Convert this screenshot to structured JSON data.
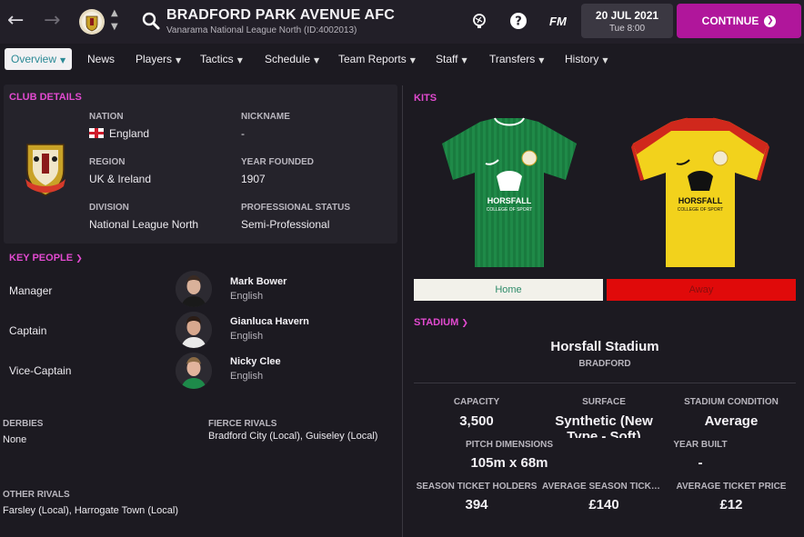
{
  "header": {
    "club_name": "BRADFORD PARK AVENUE AFC",
    "club_sub": "Vanarama National League North (ID:4002013)",
    "fm_label": "FM",
    "date": "20 JUL 2021",
    "time": "Tue 8:00",
    "continue_label": "CONTINUE"
  },
  "tabs": [
    {
      "label": "Overview"
    },
    {
      "label": "News"
    },
    {
      "label": "Players"
    },
    {
      "label": "Tactics"
    },
    {
      "label": "Schedule"
    },
    {
      "label": "Team Reports"
    },
    {
      "label": "Staff"
    },
    {
      "label": "Transfers"
    },
    {
      "label": "History"
    }
  ],
  "club_details": {
    "title": "CLUB DETAILS",
    "nation_label": "NATION",
    "nation": "England",
    "nickname_label": "NICKNAME",
    "nickname": "-",
    "region_label": "REGION",
    "region": "UK & Ireland",
    "founded_label": "YEAR FOUNDED",
    "founded": "1907",
    "division_label": "DIVISION",
    "division": "National League North",
    "status_label": "PROFESSIONAL STATUS",
    "status": "Semi-Professional"
  },
  "key_people": {
    "title": "KEY PEOPLE",
    "people": [
      {
        "role": "Manager",
        "name": "Mark Bower",
        "nationality": "English"
      },
      {
        "role": "Captain",
        "name": "Gianluca Havern",
        "nationality": "English"
      },
      {
        "role": "Vice-Captain",
        "name": "Nicky Clee",
        "nationality": "English"
      }
    ]
  },
  "rivals": {
    "derbies_label": "DERBIES",
    "derbies": "None",
    "fierce_label": "FIERCE RIVALS",
    "fierce": "Bradford City (Local), Guiseley (Local)",
    "other_label": "OTHER RIVALS",
    "other": "Farsley (Local), Harrogate Town (Local)"
  },
  "kits": {
    "title": "KITS",
    "home_label": "Home",
    "away_label": "Away",
    "sponsor_line1": "HORSFALL",
    "sponsor_line2": "COLLEGE OF SPORT",
    "colors": {
      "home": "#1f8a48",
      "away": "#f2d21c",
      "away_trim": "#d0281c"
    }
  },
  "stadium": {
    "title": "STADIUM",
    "name": "Horsfall Stadium",
    "city": "BRADFORD",
    "capacity_label": "CAPACITY",
    "capacity": "3,500",
    "surface_label": "SURFACE",
    "surface": "Synthetic (New Type - Soft)",
    "condition_label": "STADIUM CONDITION",
    "condition": "Average",
    "pitch_label": "PITCH DIMENSIONS",
    "pitch": "105m x 68m",
    "year_built_label": "YEAR BUILT",
    "year_built": "-",
    "season_holders_label": "SEASON TICKET HOLDERS",
    "season_holders": "394",
    "avg_season_label": "AVERAGE SEASON TICKET PRICE",
    "avg_season": "£140",
    "avg_ticket_label": "AVERAGE TICKET PRICE",
    "avg_ticket": "£12"
  },
  "colors": {
    "accent": "#e24ad0",
    "continue": "#b0169b",
    "background": "#1c1a21"
  }
}
